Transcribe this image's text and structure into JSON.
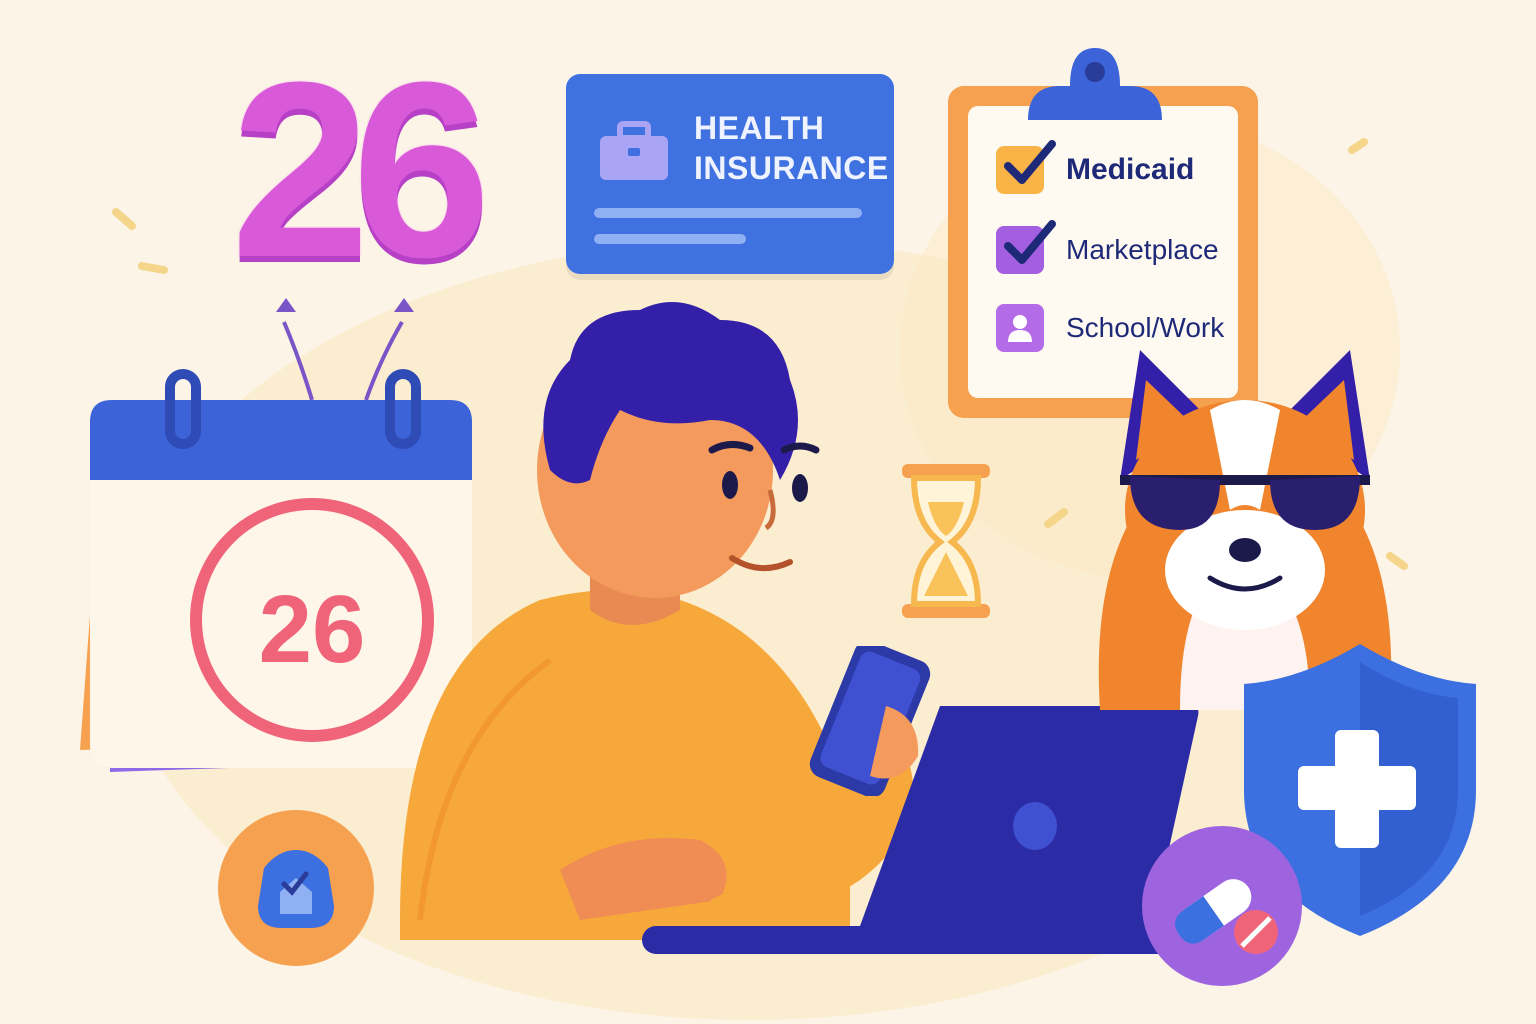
{
  "balloon": {
    "number": "26"
  },
  "insurance_card": {
    "title": "HEALTH INSURANCE"
  },
  "clipboard": {
    "items": [
      {
        "label": "Medicaid",
        "checked": true,
        "box_color": "#f9b347"
      },
      {
        "label": "Marketplace",
        "checked": true,
        "box_color": "#a45ee0"
      },
      {
        "label": "School/Work",
        "checked": false,
        "box_color": "#b46be8"
      }
    ]
  },
  "calendar": {
    "day": "26"
  },
  "colors": {
    "background": "#fcf4e6",
    "card_blue": "#3f72e0",
    "clipboard_orange": "#f6a14f",
    "calendar_red": "#f0647a",
    "ink_navy": "#1e2a78",
    "balloon_pink": "#d95ad8"
  },
  "icons": [
    "briefcase-icon",
    "hourglass-icon",
    "home-check-icon",
    "pill-icon",
    "shield-cross-icon",
    "smartphone-icon",
    "laptop-icon",
    "person-icon",
    "checkmark-icon"
  ]
}
